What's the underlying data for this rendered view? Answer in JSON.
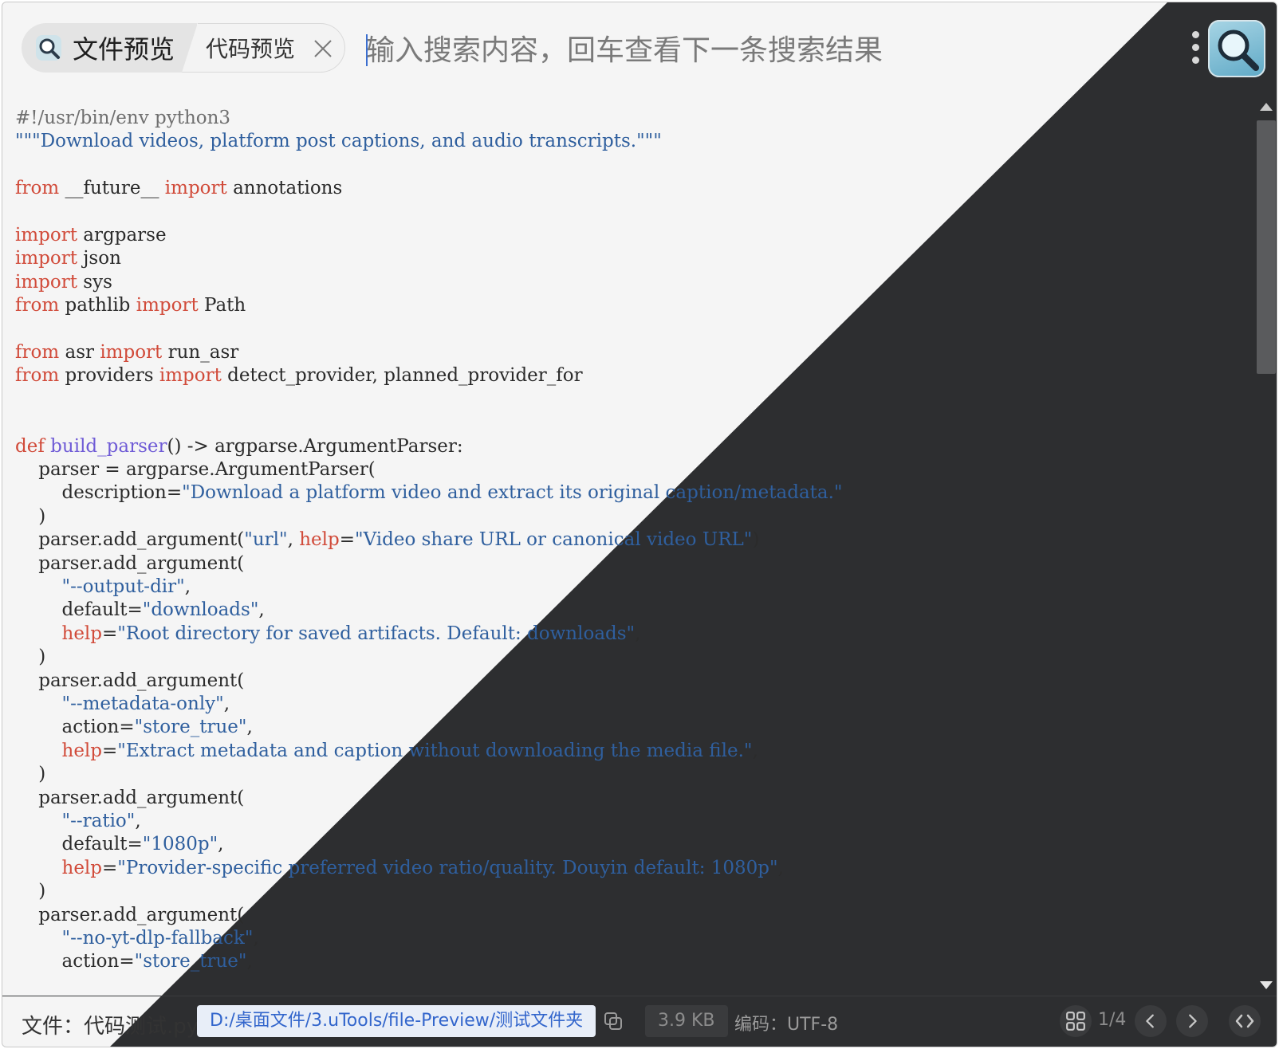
{
  "header": {
    "tabs": [
      {
        "label": "文件预览",
        "icon": "magnifier-icon"
      },
      {
        "label": "代码预览",
        "icon": "close-icon"
      }
    ],
    "search": {
      "placeholder": "输入搜索内容，回车查看下一条搜索结果"
    },
    "menu_icon": "more-vertical-icon",
    "logo_icon": "app-logo-magnifier-icon"
  },
  "code": {
    "lines": [
      [
        [
          "comment",
          "#!/usr/bin/env python3"
        ]
      ],
      [
        [
          "str",
          "\"\"\"Download videos, platform post captions, and audio transcripts.\"\"\""
        ]
      ],
      [],
      [
        [
          "kw",
          "from"
        ],
        [
          "plain",
          " __future__ "
        ],
        [
          "kw",
          "import"
        ],
        [
          "plain",
          " annotations"
        ]
      ],
      [],
      [
        [
          "kw",
          "import"
        ],
        [
          "plain",
          " argparse"
        ]
      ],
      [
        [
          "kw",
          "import"
        ],
        [
          "plain",
          " json"
        ]
      ],
      [
        [
          "kw",
          "import"
        ],
        [
          "plain",
          " sys"
        ]
      ],
      [
        [
          "kw",
          "from"
        ],
        [
          "plain",
          " pathlib "
        ],
        [
          "kw",
          "import"
        ],
        [
          "plain",
          " Path"
        ]
      ],
      [],
      [
        [
          "kw",
          "from"
        ],
        [
          "plain",
          " asr "
        ],
        [
          "kw",
          "import"
        ],
        [
          "plain",
          " run_asr"
        ]
      ],
      [
        [
          "kw",
          "from"
        ],
        [
          "plain",
          " providers "
        ],
        [
          "kw",
          "import"
        ],
        [
          "plain",
          " detect_provider, planned_provider_for"
        ]
      ],
      [],
      [],
      [
        [
          "kw",
          "def"
        ],
        [
          "plain",
          " "
        ],
        [
          "func",
          "build_parser"
        ],
        [
          "plain",
          "() -> argparse.ArgumentParser:"
        ]
      ],
      [
        [
          "plain",
          "    parser = argparse.ArgumentParser("
        ]
      ],
      [
        [
          "plain",
          "        description="
        ],
        [
          "str",
          "\"Download a platform video and extract its original caption/metadata.\""
        ]
      ],
      [
        [
          "plain",
          "    )"
        ]
      ],
      [
        [
          "plain",
          "    parser.add_argument("
        ],
        [
          "str",
          "\"url\""
        ],
        [
          "plain",
          ", "
        ],
        [
          "kw",
          "help"
        ],
        [
          "plain",
          "="
        ],
        [
          "str",
          "\"Video share URL or canonical video URL\""
        ],
        [
          "plain",
          ")"
        ]
      ],
      [
        [
          "plain",
          "    parser.add_argument("
        ]
      ],
      [
        [
          "plain",
          "        "
        ],
        [
          "str",
          "\"--output-dir\""
        ],
        [
          "plain",
          ","
        ]
      ],
      [
        [
          "plain",
          "        default="
        ],
        [
          "str",
          "\"downloads\""
        ],
        [
          "plain",
          ","
        ]
      ],
      [
        [
          "plain",
          "        "
        ],
        [
          "kw",
          "help"
        ],
        [
          "plain",
          "="
        ],
        [
          "str",
          "\"Root directory for saved artifacts. Default: downloads\""
        ],
        [
          "plain",
          ","
        ]
      ],
      [
        [
          "plain",
          "    )"
        ]
      ],
      [
        [
          "plain",
          "    parser.add_argument("
        ]
      ],
      [
        [
          "plain",
          "        "
        ],
        [
          "str",
          "\"--metadata-only\""
        ],
        [
          "plain",
          ","
        ]
      ],
      [
        [
          "plain",
          "        action="
        ],
        [
          "str",
          "\"store_true\""
        ],
        [
          "plain",
          ","
        ]
      ],
      [
        [
          "plain",
          "        "
        ],
        [
          "kw",
          "help"
        ],
        [
          "plain",
          "="
        ],
        [
          "str",
          "\"Extract metadata and caption without downloading the media file.\""
        ],
        [
          "plain",
          ","
        ]
      ],
      [
        [
          "plain",
          "    )"
        ]
      ],
      [
        [
          "plain",
          "    parser.add_argument("
        ]
      ],
      [
        [
          "plain",
          "        "
        ],
        [
          "str",
          "\"--ratio\""
        ],
        [
          "plain",
          ","
        ]
      ],
      [
        [
          "plain",
          "        default="
        ],
        [
          "str",
          "\"1080p\""
        ],
        [
          "plain",
          ","
        ]
      ],
      [
        [
          "plain",
          "        "
        ],
        [
          "kw",
          "help"
        ],
        [
          "plain",
          "="
        ],
        [
          "str",
          "\"Provider-specific preferred video ratio/quality. Douyin default: 1080p\""
        ],
        [
          "plain",
          ","
        ]
      ],
      [
        [
          "plain",
          "    )"
        ]
      ],
      [
        [
          "plain",
          "    parser.add_argument("
        ]
      ],
      [
        [
          "plain",
          "        "
        ],
        [
          "str",
          "\"--no-yt-dlp-fallback\""
        ],
        [
          "plain",
          ","
        ]
      ],
      [
        [
          "plain",
          "        action="
        ],
        [
          "str",
          "\"store_true\""
        ],
        [
          "plain",
          ","
        ]
      ]
    ]
  },
  "footer": {
    "file_name": "文件：代码测试.py",
    "file_path": "D:/桌面文件/3.uTools/file-Preview/测试文件夹",
    "copy_icon": "copy-icon",
    "file_size": "3.9 KB",
    "encoding": "编码：UTF-8",
    "grid_icon": "grid-icon",
    "page": "1/4",
    "prev_icon": "chevron-left-icon",
    "next_icon": "chevron-right-icon",
    "code_icon": "code-icon"
  },
  "colors": {
    "keyword": "#d14b3a",
    "function": "#6f5bd6",
    "string": "#2f5f9e",
    "comment": "#6f6f6f",
    "path_link": "#3366cc",
    "dark_theme_bg": "#2d2e30"
  }
}
